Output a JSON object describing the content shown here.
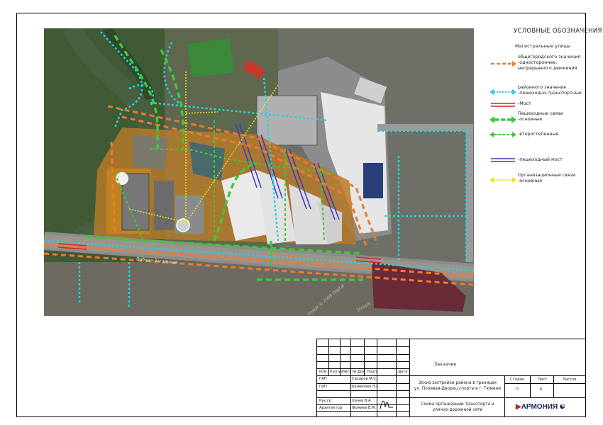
{
  "legend": {
    "title": "УСЛОВНЫЕ ОБОЗНАЧЕНИЯ",
    "section_main_streets": "Магистральные улицы",
    "items": [
      {
        "label": "общегородского значения\n-одностороннее,\nнепрерывного движения",
        "color": "#f07a2a",
        "style": "dashed-arrow"
      },
      {
        "label": "районного значения\n-пешеходно-транспортные",
        "color": "#22d3e0",
        "style": "dotted-arrow"
      },
      {
        "label": "-Мост",
        "color": "#e02020",
        "style": "double-line"
      },
      {
        "label": "Пешеходные связи\n-основные",
        "color": "#3ec83e",
        "style": "thick-dashed-arrow"
      },
      {
        "label": "-второстепенные",
        "color": "#3ec83e",
        "style": "thin-dashed-arrow"
      },
      {
        "label": "-пешеходный мост",
        "color": "#3a3ad0",
        "style": "double-line"
      },
      {
        "label": "Организационные связи\n-основные",
        "color": "#f2e21a",
        "style": "dotted-arrow"
      }
    ]
  },
  "map": {
    "street_label": "Победа-Загальная",
    "watermark_1": "Image © 2009 Digital",
    "watermark_2": "Stream"
  },
  "stamp": {
    "header_cols": [
      "Изм",
      "Кол.уч",
      "Лист",
      "№ Док",
      "Подп.",
      "Дата"
    ],
    "roles": [
      {
        "role": "ГАП",
        "name": "Сахаров М.С."
      },
      {
        "role": "ГИП",
        "name": "Баженова Э.С."
      },
      {
        "role": "",
        "name": ""
      },
      {
        "role": "Рук.гр",
        "name": "Хичев В.А."
      },
      {
        "role": "Архитектор",
        "name": "Фомиев Е.М."
      }
    ],
    "customer_label": "Заказчик",
    "project_title": "Эскиз застройки района в границах\nул. Полевая-Дворец спорта в г. Тюмени",
    "stage_header": "Стадия",
    "sheet_header": "Лист",
    "sheets_header": "Листов",
    "stage_value": "П",
    "sheet_value": "6",
    "sheets_value": "",
    "drawing_title": "Схема организации транспорта и\nулично-дорожной сети",
    "company": "АРМОНИЯ"
  }
}
